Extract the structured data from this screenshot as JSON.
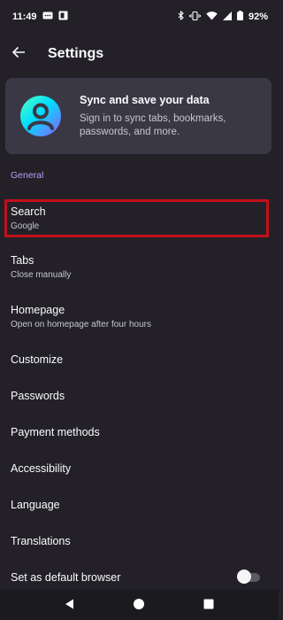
{
  "status_bar": {
    "time": "11:49",
    "battery": "92%",
    "icons": [
      "messages-icon",
      "notification-icon",
      "bluetooth-icon",
      "vibrate-icon",
      "wifi-icon",
      "signal-icon",
      "battery-icon"
    ]
  },
  "header": {
    "back_icon": "arrow-left-icon",
    "title": "Settings"
  },
  "account": {
    "title": "Sync and save your data",
    "subtitle": "Sign in to sync tabs, bookmarks, passwords, and more.",
    "avatar_colors": [
      "#54ffbd",
      "#00ddff",
      "#9059ff"
    ]
  },
  "sections": {
    "general": "General"
  },
  "items": [
    {
      "title": "Search",
      "subtitle": "Google"
    },
    {
      "title": "Tabs",
      "subtitle": "Close manually"
    },
    {
      "title": "Homepage",
      "subtitle": "Open on homepage after four hours"
    },
    {
      "title": "Customize"
    },
    {
      "title": "Passwords"
    },
    {
      "title": "Payment methods"
    },
    {
      "title": "Accessibility"
    },
    {
      "title": "Language"
    },
    {
      "title": "Translations"
    },
    {
      "title": "Set as default browser",
      "toggle": "off"
    }
  ],
  "nav_bar": {
    "buttons": [
      "back-triangle-icon",
      "home-circle-icon",
      "recents-square-icon"
    ]
  },
  "colors": {
    "background": "#232127",
    "card": "#3a3844",
    "accent": "#b99cf6",
    "highlight": "#c2101b"
  }
}
